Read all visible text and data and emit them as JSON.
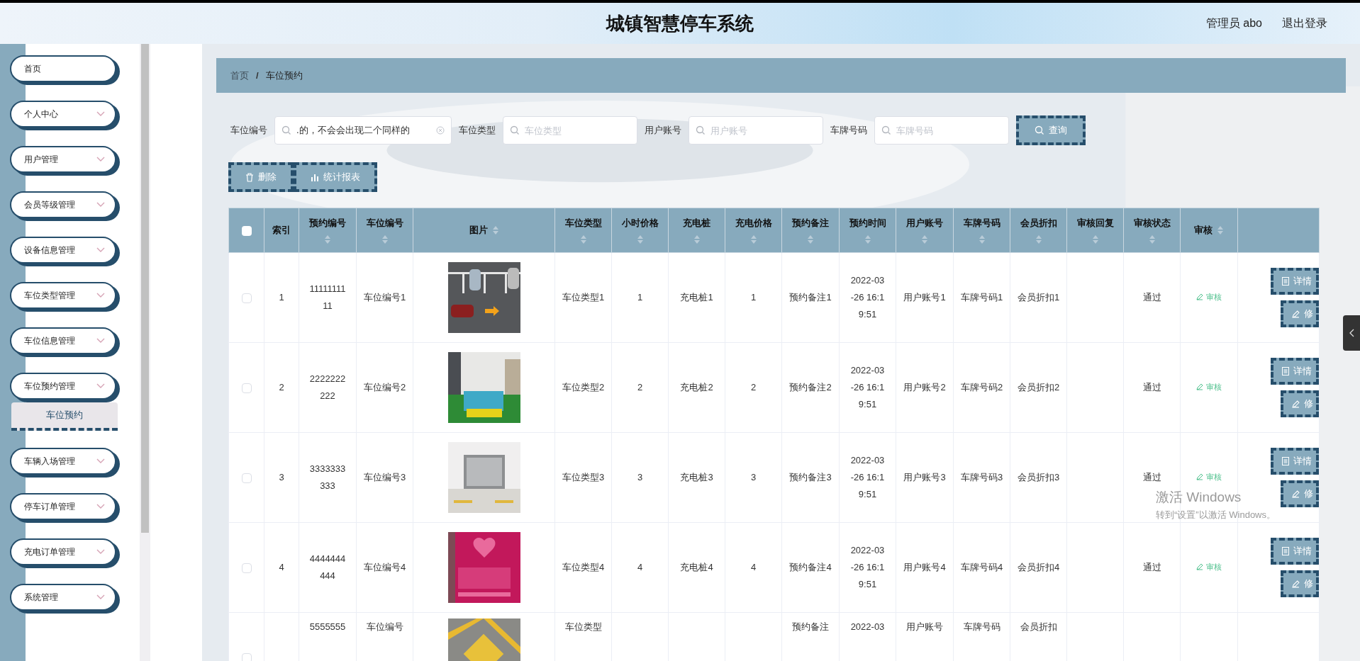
{
  "header": {
    "title": "城镇智慧停车系统",
    "user": "管理员 abo",
    "logout": "退出登录"
  },
  "sidebar": {
    "items": [
      {
        "label": "首页",
        "kind": "link"
      },
      {
        "label": "个人中心",
        "kind": "menu"
      },
      {
        "label": "用户管理",
        "kind": "menu"
      },
      {
        "label": "会员等级管理",
        "kind": "menu"
      },
      {
        "label": "设备信息管理",
        "kind": "menu"
      },
      {
        "label": "车位类型管理",
        "kind": "menu"
      },
      {
        "label": "车位信息管理",
        "kind": "menu"
      },
      {
        "label": "车位预约管理",
        "kind": "menu",
        "children": [
          {
            "label": "车位预约",
            "selected": true
          }
        ]
      },
      {
        "label": "车辆入场管理",
        "kind": "menu"
      },
      {
        "label": "停车订单管理",
        "kind": "menu"
      },
      {
        "label": "充电订单管理",
        "kind": "menu"
      },
      {
        "label": "系统管理",
        "kind": "menu"
      }
    ]
  },
  "breadcrumb": {
    "items": [
      "首页",
      "车位预约"
    ],
    "separator": "/"
  },
  "search": {
    "fields": [
      {
        "label": "车位编号",
        "value": ".的，不会会出现二个同样的"
      },
      {
        "label": "车位类型",
        "placeholder": "车位类型"
      },
      {
        "label": "用户账号",
        "placeholder": "用户账号"
      },
      {
        "label": "车牌号码",
        "placeholder": "车牌号码"
      }
    ],
    "button": "查询"
  },
  "actions": [
    {
      "kind": "delete",
      "label": "删除"
    },
    {
      "kind": "report",
      "label": "统计报表"
    }
  ],
  "table": {
    "select_all": {
      "checked": false
    },
    "columns": [
      {
        "label": "索引",
        "kind": "text"
      },
      {
        "label": "预约编号",
        "kind": "text"
      },
      {
        "label": "车位编号",
        "kind": "text"
      },
      {
        "label": "图片",
        "kind": "picture"
      },
      {
        "label": "车位类型",
        "kind": "text"
      },
      {
        "label": "小时价格",
        "kind": "text"
      },
      {
        "label": "充电桩",
        "kind": "text"
      },
      {
        "label": "充电价格",
        "kind": "text"
      },
      {
        "label": "预约备注",
        "kind": "text"
      },
      {
        "label": "预约时间",
        "kind": "text"
      },
      {
        "label": "用户账号",
        "kind": "text"
      },
      {
        "label": "车牌号码",
        "kind": "text"
      },
      {
        "label": "会员折扣",
        "kind": "text"
      },
      {
        "label": "审核回复",
        "kind": "text"
      },
      {
        "label": "审核状态",
        "kind": "text"
      },
      {
        "label": "审核",
        "kind": "audit"
      },
      {
        "kind": "actions"
      }
    ],
    "rows": [
      {
        "checked": false,
        "cells": [
          "1",
          "1111111111",
          "车位编号1",
          {
            "kind": "picture"
          },
          "车位类型1",
          "1",
          "充电桩1",
          "1",
          "预约备注1",
          "2022-03-26 16:19:51",
          "用户账号1",
          "车牌号码1",
          "会员折扣1",
          null,
          "通过",
          "审核",
          [
            "详情",
            "修"
          ]
        ]
      },
      {
        "checked": false,
        "cells": [
          "2",
          "2222222222",
          "车位编号2",
          {
            "kind": "picture"
          },
          "车位类型2",
          "2",
          "充电桩2",
          "2",
          "预约备注2",
          "2022-03-26 16:19:51",
          "用户账号2",
          "车牌号码2",
          "会员折扣2",
          null,
          "通过",
          "审核",
          [
            "详情",
            "修"
          ]
        ]
      },
      {
        "checked": false,
        "cells": [
          "3",
          "3333333333",
          "车位编号3",
          {
            "kind": "picture"
          },
          "车位类型3",
          "3",
          "充电桩3",
          "3",
          "预约备注3",
          "2022-03-26 16:19:51",
          "用户账号3",
          "车牌号码3",
          "会员折扣3",
          null,
          "通过",
          "审核",
          [
            "详情",
            "修"
          ]
        ]
      },
      {
        "checked": false,
        "cells": [
          "4",
          "4444444444",
          "车位编号4",
          {
            "kind": "picture"
          },
          "车位类型4",
          "4",
          "充电桩4",
          "4",
          "预约备注4",
          "2022-03-26 16:19:51",
          "用户账号4",
          "车牌号码4",
          "会员折扣4",
          null,
          "通过",
          "审核",
          [
            "详情",
            "修"
          ]
        ]
      },
      {
        "checked": false,
        "cells": [
          null,
          "5555555",
          "车位编号",
          {
            "kind": "picture"
          },
          "车位类型",
          null,
          null,
          null,
          "预约备注",
          "2022-03",
          "用户账号",
          "车牌号码",
          "会员折扣",
          null,
          null,
          null,
          null
        ]
      }
    ]
  },
  "activation_notice": {
    "title": "激活 Windows",
    "text": "转到“设置”以激活 Windows。"
  }
}
